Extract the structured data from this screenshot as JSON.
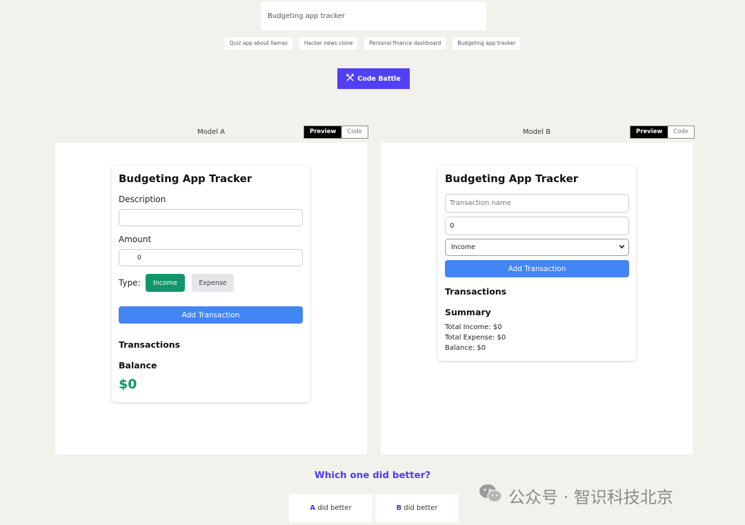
{
  "prompt": {
    "value": "Budgeting app tracker"
  },
  "suggestions": [
    "Quiz app about llamas",
    "Hacker news clone",
    "Personal finance dashboard",
    "Budgeting app tracker"
  ],
  "battle_button": {
    "label": "Code Battle",
    "icon": "crossed-swords-icon"
  },
  "model_a": {
    "label": "Model A",
    "tab_preview": "Preview",
    "tab_code": "Code",
    "app": {
      "title": "Budgeting App Tracker",
      "description_label": "Description",
      "description_value": "",
      "amount_label": "Amount",
      "amount_value": "0",
      "type_label": "Type:",
      "income_label": "Income",
      "expense_label": "Expense",
      "add_label": "Add Transaction",
      "transactions_heading": "Transactions",
      "balance_heading": "Balance",
      "balance_value": "$0"
    }
  },
  "model_b": {
    "label": "Model B",
    "tab_preview": "Preview",
    "tab_code": "Code",
    "app": {
      "title": "Budgeting App Tracker",
      "name_placeholder": "Transaction name",
      "amount_value": "0",
      "type_selected": "Income",
      "add_label": "Add Transaction",
      "transactions_heading": "Transactions",
      "summary_heading": "Summary",
      "total_income": "Total Income: $0",
      "total_expense": "Total Expense: $0",
      "balance": "Balance: $0"
    }
  },
  "vote": {
    "question": "Which one did better?",
    "a_letter": "A",
    "b_letter": "B",
    "suffix": " did better"
  },
  "watermark": {
    "text": "公众号 · 智识科技北京",
    "icon": "wechat-icon"
  },
  "colors": {
    "accent": "#5240f5",
    "income_green": "#12956b",
    "button_blue": "#4285f4"
  }
}
